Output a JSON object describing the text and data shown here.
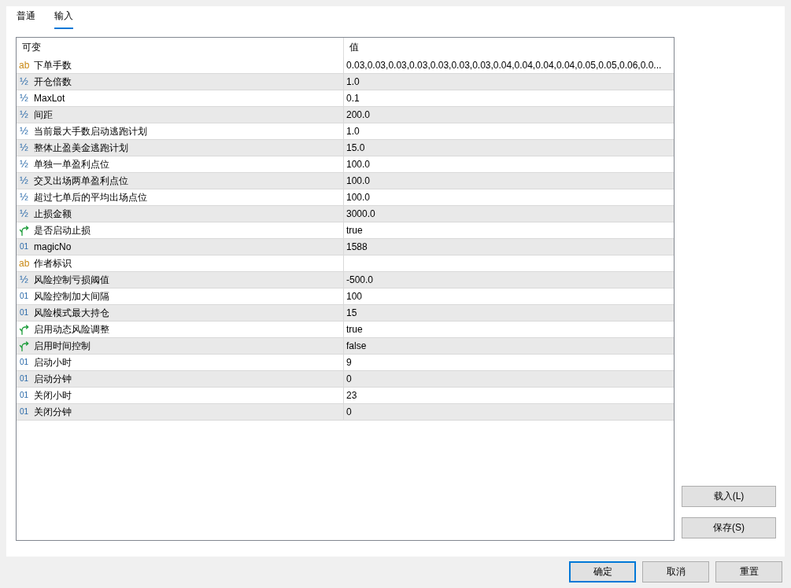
{
  "tabs": [
    {
      "label": "普通",
      "selected": false
    },
    {
      "label": "输入",
      "selected": true
    }
  ],
  "table": {
    "columns": [
      "可变",
      "值"
    ],
    "rows": [
      {
        "kind": "string",
        "type_glyph": "ab",
        "name": "下单手数",
        "value": "0.03,0.03,0.03,0.03,0.03,0.03,0.03,0.04,0.04,0.04,0.04,0.05,0.05,0.06,0.0..."
      },
      {
        "kind": "double",
        "type_glyph": "½",
        "name": "开仓倍数",
        "value": "1.0"
      },
      {
        "kind": "double",
        "type_glyph": "½",
        "name": "MaxLot",
        "value": "0.1"
      },
      {
        "kind": "double",
        "type_glyph": "½",
        "name": "间距",
        "value": "200.0"
      },
      {
        "kind": "double",
        "type_glyph": "½",
        "name": "当前最大手数启动逃跑计划",
        "value": "1.0"
      },
      {
        "kind": "double",
        "type_glyph": "½",
        "name": "整体止盈美金逃跑计划",
        "value": "15.0"
      },
      {
        "kind": "double",
        "type_glyph": "½",
        "name": "单独一单盈利点位",
        "value": "100.0"
      },
      {
        "kind": "double",
        "type_glyph": "½",
        "name": "交叉出场两单盈利点位",
        "value": "100.0"
      },
      {
        "kind": "double",
        "type_glyph": "½",
        "name": "超过七单后的平均出场点位",
        "value": "100.0"
      },
      {
        "kind": "double",
        "type_glyph": "½",
        "name": "止损金额",
        "value": "3000.0"
      },
      {
        "kind": "bool",
        "name": "是否启动止损",
        "value": "true"
      },
      {
        "kind": "int",
        "type_glyph": "01",
        "name": "magicNo",
        "value": "1588"
      },
      {
        "kind": "string",
        "type_glyph": "ab",
        "name": "作者标识"
      },
      {
        "kind": "double",
        "type_glyph": "½",
        "name": "风险控制亏损阈值",
        "value": "-500.0"
      },
      {
        "kind": "int",
        "type_glyph": "01",
        "name": "风险控制加大间隔",
        "value": "100"
      },
      {
        "kind": "int",
        "type_glyph": "01",
        "name": "风险模式最大持仓",
        "value": "15"
      },
      {
        "kind": "bool",
        "name": "启用动态风险调整",
        "value": "true"
      },
      {
        "kind": "bool",
        "name": "启用时间控制",
        "value": "false"
      },
      {
        "kind": "int",
        "type_glyph": "01",
        "name": "启动小时",
        "value": "9"
      },
      {
        "kind": "int",
        "type_glyph": "01",
        "name": "启动分钟",
        "value": "0"
      },
      {
        "kind": "int",
        "type_glyph": "01",
        "name": "关闭小时",
        "value": "23"
      },
      {
        "kind": "int",
        "type_glyph": "01",
        "name": "关闭分钟",
        "value": "0"
      }
    ]
  },
  "side_buttons": [
    "载入(L)",
    "保存(S)"
  ],
  "buttons": [
    {
      "label": "确定",
      "focused": true
    },
    {
      "label": "取消",
      "focused": false
    },
    {
      "label": "重置",
      "focused": false
    }
  ]
}
